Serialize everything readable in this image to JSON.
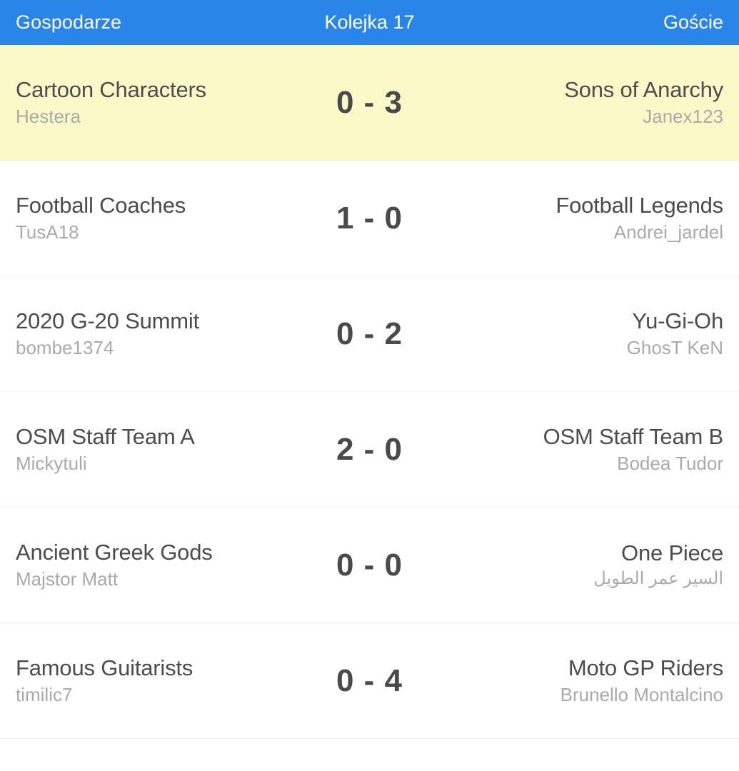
{
  "header": {
    "home_label": "Gospodarze",
    "round_label": "Kolejka 17",
    "away_label": "Goście",
    "background_color": "#2a85e8",
    "text_color": "#ffffff"
  },
  "colors": {
    "highlight_row": "#fcf9c9",
    "row_background": "#ffffff",
    "team_name": "#4c4c4c",
    "manager_name": "#aaaaaa",
    "score": "#4a4a4a",
    "separator": "#eeeeee"
  },
  "fixtures": [
    {
      "home_team": "Cartoon Characters",
      "home_manager": "Hestera",
      "home_score": "0",
      "separator": "-",
      "away_score": "3",
      "away_team": "Sons of Anarchy",
      "away_manager": "Janex123",
      "score_text": "0 - 3",
      "highlighted": true,
      "away_manager_rtl": false
    },
    {
      "home_team": "Football Coaches",
      "home_manager": "TusA18",
      "home_score": "1",
      "separator": "-",
      "away_score": "0",
      "away_team": "Football Legends",
      "away_manager": "Andrei_jardel",
      "score_text": "1 - 0",
      "highlighted": false,
      "away_manager_rtl": false
    },
    {
      "home_team": "2020 G-20 Summit",
      "home_manager": "bombe1374",
      "home_score": "0",
      "separator": "-",
      "away_score": "2",
      "away_team": "Yu-Gi-Oh",
      "away_manager": "GhosT KeN",
      "score_text": "0 - 2",
      "highlighted": false,
      "away_manager_rtl": false
    },
    {
      "home_team": "OSM Staff Team A",
      "home_manager": "Mickytuli",
      "home_score": "2",
      "separator": "-",
      "away_score": "0",
      "away_team": "OSM Staff Team B",
      "away_manager": "Bodea Tudor",
      "score_text": "2 - 0",
      "highlighted": false,
      "away_manager_rtl": false
    },
    {
      "home_team": "Ancient Greek Gods",
      "home_manager": "Majstor Matt",
      "home_score": "0",
      "separator": "-",
      "away_score": "0",
      "away_team": "One Piece",
      "away_manager": "السير عمر الطويل",
      "score_text": "0 - 0",
      "highlighted": false,
      "away_manager_rtl": true
    },
    {
      "home_team": "Famous Guitarists",
      "home_manager": "timilic7",
      "home_score": "0",
      "separator": "-",
      "away_score": "4",
      "away_team": "Moto GP Riders",
      "away_manager": "Brunello Montalcino",
      "score_text": "0 - 4",
      "highlighted": false,
      "away_manager_rtl": false
    }
  ]
}
